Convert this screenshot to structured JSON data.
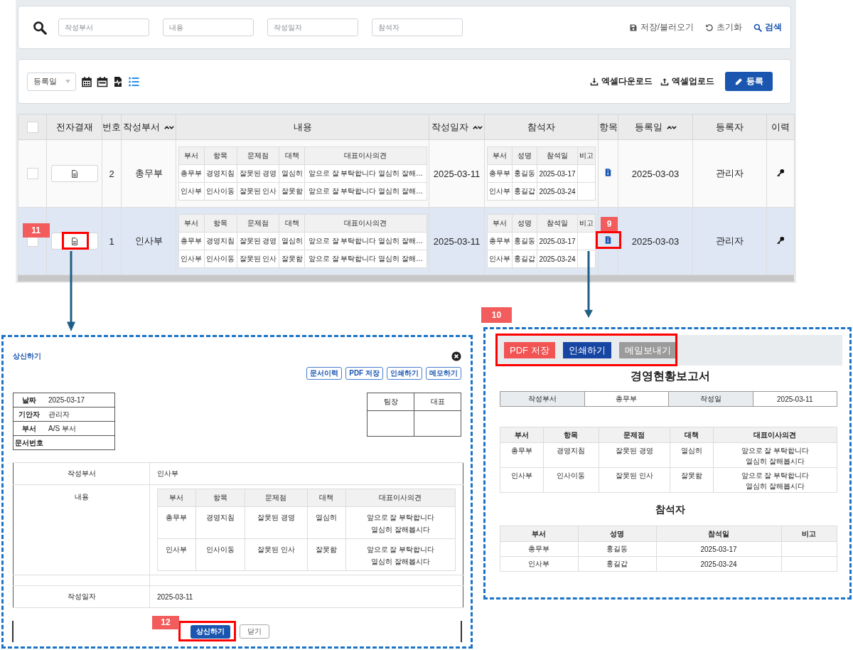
{
  "search_bar": {
    "fields": [
      {
        "placeholder": "작성부서"
      },
      {
        "placeholder": "내용"
      },
      {
        "placeholder": "작성일자"
      },
      {
        "placeholder": "참석자"
      }
    ],
    "actions": [
      {
        "kind": "save",
        "label": "저장/불러오기"
      },
      {
        "kind": "reset",
        "label": "초기화"
      },
      {
        "kind": "search",
        "label": "검색"
      }
    ]
  },
  "toolbar": {
    "date_filter": "등록일",
    "views": [
      {
        "kind": "month",
        "selected": false
      },
      {
        "kind": "week",
        "selected": false
      },
      {
        "kind": "report",
        "selected": false
      },
      {
        "kind": "list",
        "selected": true
      }
    ],
    "actions": [
      {
        "kind": "download",
        "label": "엑셀다운로드"
      },
      {
        "kind": "upload",
        "label": "엑셀업로드"
      }
    ],
    "register_button": "등록"
  },
  "table": {
    "columns": [
      {
        "kind": "check",
        "checked": false
      },
      {
        "kind": "text",
        "label": "전자결재",
        "sortable": false
      },
      {
        "kind": "text",
        "label": "번호",
        "sortable": false
      },
      {
        "kind": "text",
        "label": "작성부서",
        "sortable": true
      },
      {
        "kind": "text",
        "label": "내용",
        "sortable": false
      },
      {
        "kind": "text",
        "label": "작성일자",
        "sortable": true
      },
      {
        "kind": "text",
        "label": "참석자",
        "sortable": false
      },
      {
        "kind": "text",
        "label": "항목",
        "sortable": false
      },
      {
        "kind": "text",
        "label": "등록일",
        "sortable": true
      },
      {
        "kind": "text",
        "label": "등록자",
        "sortable": false
      },
      {
        "kind": "text",
        "label": "이력",
        "sortable": false
      }
    ],
    "rows": [
      {
        "selected": false,
        "checked": false,
        "number": "2",
        "department": "총무부",
        "content": {
          "columns": [
            "부서",
            "항목",
            "문제점",
            "대책",
            "대표이사의견"
          ],
          "rows": [
            [
              "총무부",
              "경영지침",
              "잘못된 경영",
              "열심히",
              "앞으로 잘 부탁합니다 열심히 잘해…"
            ],
            [
              "인사부",
              "인사이동",
              "잘못된 인사",
              "잘못함",
              "앞으로 잘 부탁합니다 열심히 잘해…"
            ]
          ]
        },
        "written_date": "2025-03-11",
        "attendees": {
          "columns": [
            "부서",
            "성명",
            "참석일",
            "비고"
          ],
          "rows": [
            [
              "총무부",
              "홍길동",
              "2025-03-17"
            ],
            [
              "인사부",
              "홍길갑",
              "2025-03-24"
            ]
          ]
        },
        "reg_date": "2025-03-03",
        "registrant": "관리자"
      },
      {
        "selected": true,
        "checked": false,
        "number": "1",
        "department": "인사부",
        "approval_callout": "11",
        "item_callout": "9",
        "content": {
          "columns": [
            "부서",
            "항목",
            "문제점",
            "대책",
            "대표이사의견"
          ],
          "rows": [
            [
              "총무부",
              "경영지침",
              "잘못된 경영",
              "열심히",
              "앞으로 잘 부탁합니다 열심히 잘해…"
            ],
            [
              "인사부",
              "인사이동",
              "잘못된 인사",
              "잘못함",
              "앞으로 잘 부탁합니다 열심히 잘해…"
            ]
          ]
        },
        "written_date": "2025-03-11",
        "attendees": {
          "columns": [
            "부서",
            "성명",
            "참석일",
            "비고"
          ],
          "rows": [
            [
              "총무부",
              "홍길동",
              "2025-03-17"
            ],
            [
              "인사부",
              "홍길갑",
              "2025-03-24"
            ]
          ]
        },
        "reg_date": "2025-03-03",
        "registrant": "관리자"
      }
    ]
  },
  "approval_dialog": {
    "title": "상신하기",
    "buttons": [
      "문서이력",
      "PDF 저장",
      "인쇄하기",
      "메모하기"
    ],
    "info": [
      {
        "label": "날짜",
        "value": "2025-03-17"
      },
      {
        "label": "기안자",
        "value": "관리자"
      },
      {
        "label": "부서",
        "value": "A/S 부서"
      },
      {
        "label": "문서번호"
      }
    ],
    "signers": [
      "팀장",
      "대표"
    ],
    "form": [
      {
        "kind": "text",
        "label": "작성부서",
        "value": "인사부"
      },
      {
        "kind": "table",
        "label": "내용",
        "table": {
          "columns": [
            "부서",
            "항목",
            "문제점",
            "대책",
            "대표이사의견"
          ],
          "rows": [
            [
              "총무부",
              "경영지침",
              "잘못된 경영",
              "열심히",
              "앞으로 잘 부탁합니다\n열심히 잘해봅시다"
            ],
            [
              "인사부",
              "인사이동",
              "잘못된 인사",
              "잘못함",
              "앞으로 잘 부탁합니다\n열심히 잘해봅시다"
            ]
          ]
        }
      },
      {
        "kind": "spacer"
      },
      {
        "kind": "text",
        "label": "작성일자",
        "value": "2025-03-11"
      }
    ],
    "submit": {
      "label": "상신하기",
      "callout": "12"
    },
    "close": "닫기"
  },
  "report_preview": {
    "callout": "10",
    "buttons": [
      {
        "kind": "pdf",
        "label": "PDF 저장"
      },
      {
        "kind": "print",
        "label": "인쇄하기"
      },
      {
        "kind": "mail",
        "label": "메일보내기"
      }
    ],
    "title": "경영현황보고서",
    "meta": [
      {
        "label": "작성부서",
        "value": "총무부"
      },
      {
        "label": "작성일",
        "value": "2025-03-11"
      }
    ],
    "items": {
      "columns": [
        "부서",
        "항목",
        "문제점",
        "대책",
        "대표이사의견"
      ],
      "rows": [
        [
          "총무부",
          "경영지침",
          "잘못된 경영",
          "열심히",
          "앞으로 잘 부탁합니다\n열심히 잘해봅시다"
        ],
        [
          "인사부",
          "인사이동",
          "잘못된 인사",
          "잘못함",
          "앞으로 잘 부탁합니다\n열심히 잘해봅시다"
        ]
      ]
    },
    "attendee_title": "참석자",
    "attendees": {
      "columns": [
        "부서",
        "성명",
        "참석일",
        "비고"
      ],
      "rows": [
        [
          "총무부",
          "홍길동",
          "2025-03-17"
        ],
        [
          "인사부",
          "홍길갑",
          "2025-03-24"
        ]
      ]
    }
  }
}
